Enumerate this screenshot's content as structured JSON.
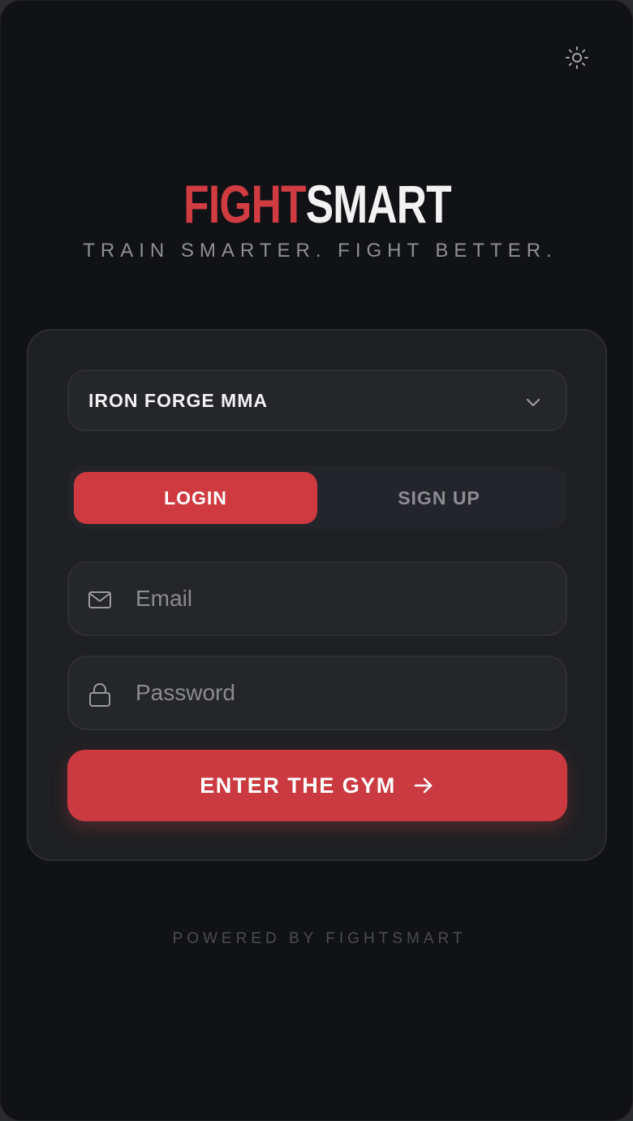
{
  "header": {
    "theme_toggle_icon": "sun-icon"
  },
  "brand": {
    "part1": "FIGHT",
    "part2": "SMART",
    "accent_color": "#d03c41",
    "tagline": "TRAIN SMARTER. FIGHT BETTER."
  },
  "form": {
    "gym_select": {
      "selected": "IRON FORGE MMA",
      "icon": "chevron-down-icon"
    },
    "tabs": [
      {
        "label": "LOGIN",
        "active": true
      },
      {
        "label": "SIGN UP",
        "active": false
      }
    ],
    "email": {
      "placeholder": "Email",
      "value": "",
      "icon": "mail-icon"
    },
    "password": {
      "placeholder": "Password",
      "value": "",
      "icon": "lock-icon"
    },
    "submit": {
      "label": "ENTER THE GYM",
      "icon": "arrow-right-icon"
    }
  },
  "footer": {
    "text": "POWERED BY FIGHTSMART"
  }
}
